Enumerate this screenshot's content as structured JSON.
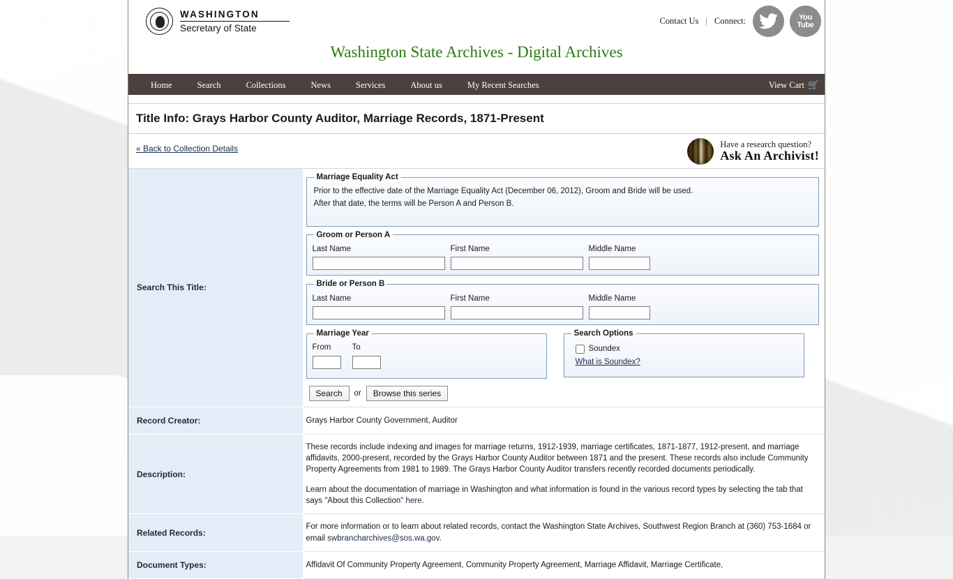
{
  "header": {
    "brand_top": "WASHINGTON",
    "brand_bottom": "Secretary of State",
    "seal_icon": "state-seal-icon",
    "contact_label": "Contact Us",
    "separator": "|",
    "connect_label": "Connect:",
    "twitter_icon": "twitter-bird-icon",
    "youtube_icon": "youtube-icon",
    "youtube_line1": "You",
    "youtube_line2": "Tube",
    "site_title": "Washington State Archives - Digital Archives"
  },
  "nav": {
    "items": [
      {
        "label": "Home"
      },
      {
        "label": "Search"
      },
      {
        "label": "Collections"
      },
      {
        "label": "News"
      },
      {
        "label": "Services"
      },
      {
        "label": "About us"
      },
      {
        "label": "My Recent Searches"
      }
    ],
    "cart_label": "View Cart",
    "cart_icon": "shopping-cart-icon"
  },
  "page": {
    "title": "Title Info: Grays Harbor County Auditor, Marriage Records, 1871-Present",
    "back_link": "« Back to Collection Details",
    "ask": {
      "question": "Have a research question?",
      "headline": "Ask An Archivist!",
      "image_icon": "book-stack-icon"
    }
  },
  "search_panel": {
    "label": "Search This Title:",
    "marriage_equality": {
      "legend": "Marriage Equality Act",
      "line1": "Prior to the effective date of the Marriage Equality Act (December 06, 2012), Groom and Bride will be used.",
      "line2": "After that date, the terms will be Person A and Person B."
    },
    "groom": {
      "legend": "Groom or Person A",
      "last_label": "Last Name",
      "first_label": "First Name",
      "middle_label": "Middle Name",
      "last_value": "",
      "first_value": "",
      "middle_value": ""
    },
    "bride": {
      "legend": "Bride or Person B",
      "last_label": "Last Name",
      "first_label": "First Name",
      "middle_label": "Middle Name",
      "last_value": "",
      "first_value": "",
      "middle_value": ""
    },
    "marriage_year": {
      "legend": "Marriage Year",
      "from_label": "From",
      "to_label": "To",
      "from_value": "",
      "to_value": ""
    },
    "search_options": {
      "legend": "Search Options",
      "soundex_label": "Soundex",
      "soundex_checked": false,
      "soundex_help": "What is Soundex?"
    },
    "search_button": "Search",
    "or_text": "or",
    "browse_button": "Browse this series"
  },
  "info_rows": [
    {
      "label": "Record Creator:",
      "text": "Grays Harbor County Government, Auditor"
    },
    {
      "label": "Description:",
      "para1": "These records include indexing and images for marriage returns, 1912-1939, marriage certificates, 1871-1877, 1912-present, and marriage affidavits, 2000-present, recorded by the Grays Harbor County Auditor between 1871 and the present. These records also include Community Property Agreements from 1981 to 1989. The Grays Harbor County Auditor transfers recently recorded documents periodically.",
      "para2_before": "Learn about the documentation of marriage in Washington and what information is found in the various record types by selecting the tab that says \"About this Collection\" ",
      "para2_link": "here",
      "para2_after": "."
    },
    {
      "label": "Related Records:",
      "text_before": "For more information or to learn about related records, contact the Washington State Archives, Southwest Region Branch at (360) 753-1684 or email ",
      "link": "swbrancharchives@sos.wa.gov",
      "text_after": "."
    },
    {
      "label": "Document Types:",
      "text": "Affidavit Of Community Property Agreement, Community Property Agreement, Marriage Affidavit, Marriage Certificate,"
    }
  ],
  "colors": {
    "nav_bg": "#4b413e",
    "title_green": "#2b7a10",
    "label_cell_bg": "#e4edf7",
    "fieldset_border": "#7f9db9",
    "link": "#1a2a4a"
  }
}
